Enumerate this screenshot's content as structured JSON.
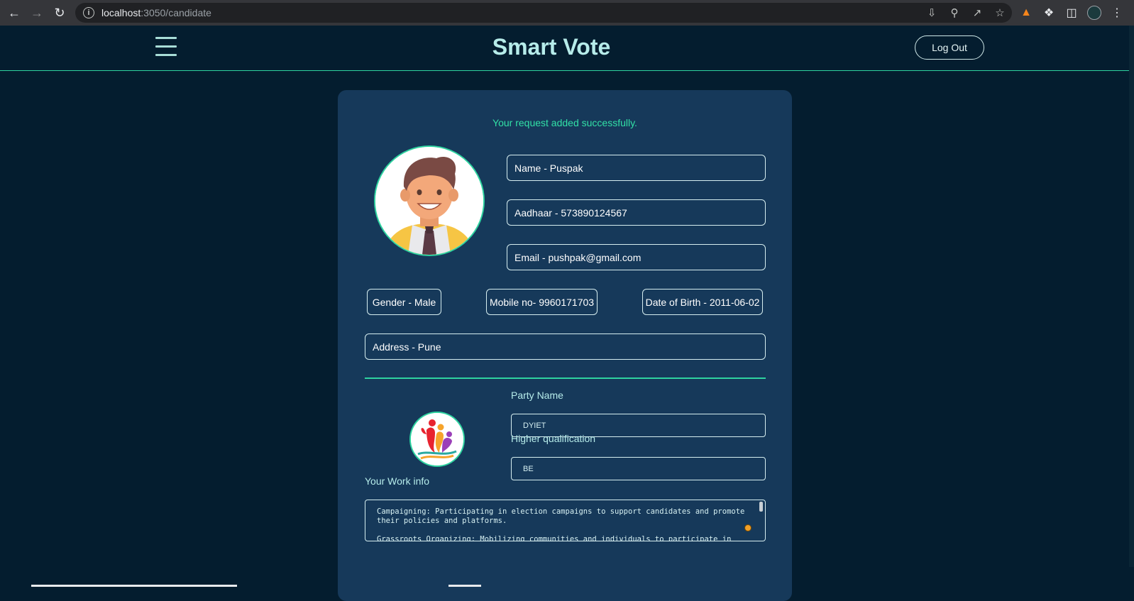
{
  "browser": {
    "url_host": "localhost",
    "url_path": ":3050/candidate",
    "icons": [
      "back-icon",
      "forward-icon",
      "reload-icon",
      "info-icon",
      "install-icon",
      "zoom-icon",
      "share-icon",
      "bookmark-star-icon",
      "metamask-fox-icon",
      "extensions-puzzle-icon",
      "side-panel-icon",
      "profile-avatar-icon",
      "menu-kebab-icon"
    ]
  },
  "header": {
    "title": "Smart Vote",
    "logout_label": "Log Out",
    "accent_color": "#2ed3a0"
  },
  "card": {
    "success_message": "Your request added successfully.",
    "name": "Name - Puspak",
    "aadhaar": "Aadhaar - 573890124567",
    "email": "Email - pushpak@gmail.com",
    "gender": "Gender - Male",
    "mobile": "Mobile no- 9960171703",
    "dob": "Date of Birth - 2011-06-02",
    "address": "Address - Pune",
    "party_name_label": "Party Name",
    "party_name_value": "DYIET",
    "qualification_label": "Higher qualification",
    "qualification_value": "BE",
    "work_info_label": "Your Work info",
    "work_info_text": "Campaigning: Participating in election campaigns to support candidates and promote their policies and platforms.\n\nGrassroots Organizing: Mobilizing communities and individuals to participate in political"
  }
}
